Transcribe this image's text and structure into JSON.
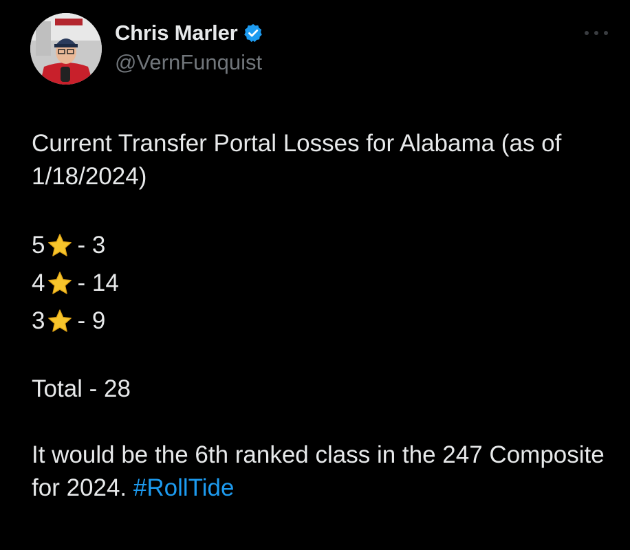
{
  "author": {
    "display_name": "Chris Marler",
    "handle": "@VernFunquist",
    "verified": true,
    "avatar_icon": "avatar-photo"
  },
  "tweet": {
    "intro": "Current Transfer Portal Losses for Alabama (as of 1/18/2024)",
    "ratings": [
      {
        "stars": "5",
        "sep": "- 3"
      },
      {
        "stars": "4",
        "sep": "- 14"
      },
      {
        "stars": "3",
        "sep": "- 9"
      }
    ],
    "total": "Total - 28",
    "closing_text": "It would be the 6th ranked class in the 247 Composite for 2024.",
    "hashtag": "#RollTide"
  },
  "colors": {
    "background": "#000000",
    "text": "#e7e9ea",
    "secondary": "#71767b",
    "link": "#1d9bf0",
    "verified": "#1d9bf0",
    "star": "#f7c52b"
  }
}
